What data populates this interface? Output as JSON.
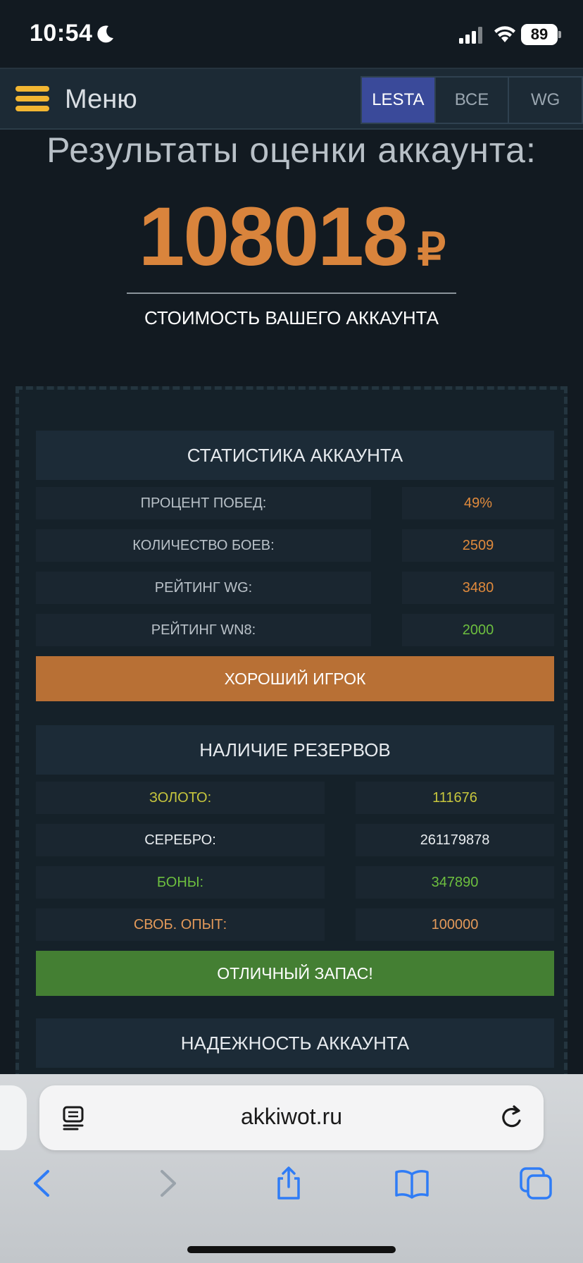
{
  "status_bar": {
    "time": "10:54",
    "battery": "89"
  },
  "nav": {
    "menu_label": "Меню",
    "tabs": [
      {
        "label": "LESTA",
        "active": true
      },
      {
        "label": "ВСЕ",
        "active": false
      },
      {
        "label": "WG",
        "active": false
      }
    ]
  },
  "result": {
    "title": "Результаты оценки аккаунта:",
    "price": "108018",
    "currency": "₽",
    "caption": "СТОИМОСТЬ ВАШЕГО АККАУНТА"
  },
  "stats": {
    "header": "СТАТИСТИКА АККАУНТА",
    "rows": [
      {
        "label": "ПРОЦЕНТ ПОБЕД:",
        "value": "49%",
        "value_color": "#e08a3c"
      },
      {
        "label": "КОЛИЧЕСТВО БОЕВ:",
        "value": "2509",
        "value_color": "#e08a3c"
      },
      {
        "label": "РЕЙТИНГ WG:",
        "value": "3480",
        "value_color": "#e08a3c"
      },
      {
        "label": "РЕЙТИНГ WN8:",
        "value": "2000",
        "value_color": "#6dbf3f"
      }
    ],
    "verdict": "ХОРОШИЙ ИГРОК",
    "verdict_color": "#b87035"
  },
  "reserves": {
    "header": "НАЛИЧИЕ РЕЗЕРВОВ",
    "rows": [
      {
        "label": "ЗОЛОТО:",
        "value": "111676",
        "color": "#c7c63d"
      },
      {
        "label": "СЕРЕБРО:",
        "value": "261179878",
        "color": "#e8ecef"
      },
      {
        "label": "БОНЫ:",
        "value": "347890",
        "color": "#6dbf3f"
      },
      {
        "label": "СВОБ. ОПЫТ:",
        "value": "100000",
        "color": "#e49a5a"
      }
    ],
    "verdict": "ОТЛИЧНЫЙ ЗАПАС!",
    "verdict_color": "#447f33"
  },
  "reliability": {
    "header": "НАДЕЖНОСТЬ АККАУНТА"
  },
  "browser": {
    "url": "akkiwot.ru",
    "accent_color": "#2f7cf6"
  }
}
